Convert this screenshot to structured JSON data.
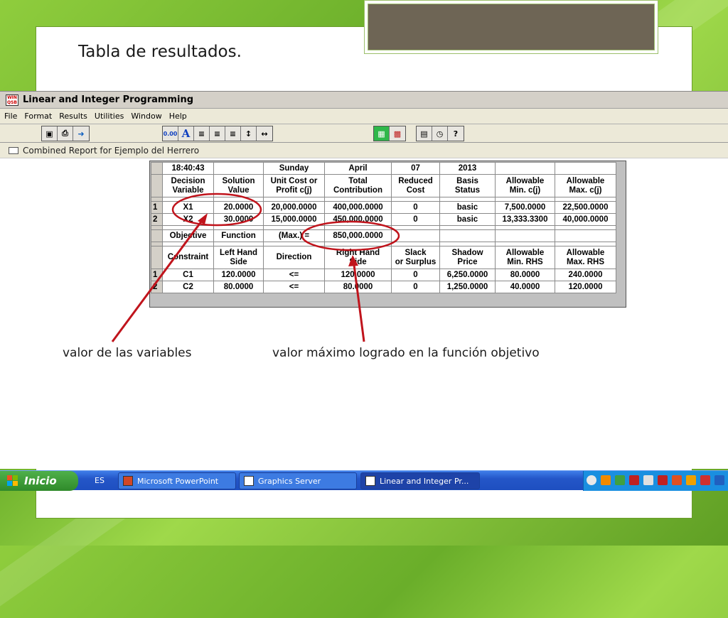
{
  "slide": {
    "title": "Tabla de resultados.",
    "annotation_left": "valor de las variables",
    "annotation_right": "valor máximo logrado en la función objetivo"
  },
  "app": {
    "title": "Linear and Integer Programming",
    "menu": [
      "File",
      "Format",
      "Results",
      "Utilities",
      "Window",
      "Help"
    ],
    "toolbar_zero_label": "0.00",
    "toolbar_font_label": "A",
    "report_title": "Combined Report for Ejemplo del Herrero"
  },
  "report": {
    "header_row": [
      "18:40:43",
      "",
      "Sunday",
      "April",
      "07",
      "2013",
      "",
      ""
    ],
    "col_heads": [
      [
        "Decision",
        "Variable"
      ],
      [
        "Solution",
        "Value"
      ],
      [
        "Unit Cost or",
        "Profit c(j)"
      ],
      [
        "Total",
        "Contribution"
      ],
      [
        "Reduced",
        "Cost"
      ],
      [
        "Basis",
        "Status"
      ],
      [
        "Allowable",
        "Min. c(j)"
      ],
      [
        "Allowable",
        "Max. c(j)"
      ]
    ],
    "variables": [
      {
        "idx": "1",
        "cells": [
          "X1",
          "20.0000",
          "20,000.0000",
          "400,000.0000",
          "0",
          "basic",
          "7,500.0000",
          "22,500.0000"
        ]
      },
      {
        "idx": "2",
        "cells": [
          "X2",
          "30.0000",
          "15,000.0000",
          "450,000.0000",
          "0",
          "basic",
          "13,333.3300",
          "40,000.0000"
        ]
      }
    ],
    "objective_row": [
      "Objective",
      "Function",
      "(Max.) =",
      "850,000.0000",
      "",
      "",
      "",
      ""
    ],
    "constraint_heads": [
      [
        "Constraint"
      ],
      [
        "Left Hand",
        "Side"
      ],
      [
        "Direction"
      ],
      [
        "Right Hand",
        "Side"
      ],
      [
        "Slack",
        "or Surplus"
      ],
      [
        "Shadow",
        "Price"
      ],
      [
        "Allowable",
        "Min. RHS"
      ],
      [
        "Allowable",
        "Max. RHS"
      ]
    ],
    "constraints": [
      {
        "idx": "1",
        "cells": [
          "C1",
          "120.0000",
          "<=",
          "120.0000",
          "0",
          "6,250.0000",
          "80.0000",
          "240.0000"
        ]
      },
      {
        "idx": "2",
        "cells": [
          "C2",
          "80.0000",
          "<=",
          "80.0000",
          "0",
          "1,250.0000",
          "40.0000",
          "120.0000"
        ]
      }
    ]
  },
  "taskbar": {
    "start_label": "Inicio",
    "language": "ES",
    "buttons": [
      "Microsoft PowerPoint",
      "Graphics Server",
      "Linear and Integer Pr..."
    ]
  },
  "colors": {
    "annotation_red": "#c0141c",
    "slide_green": "#8fcd3d"
  }
}
